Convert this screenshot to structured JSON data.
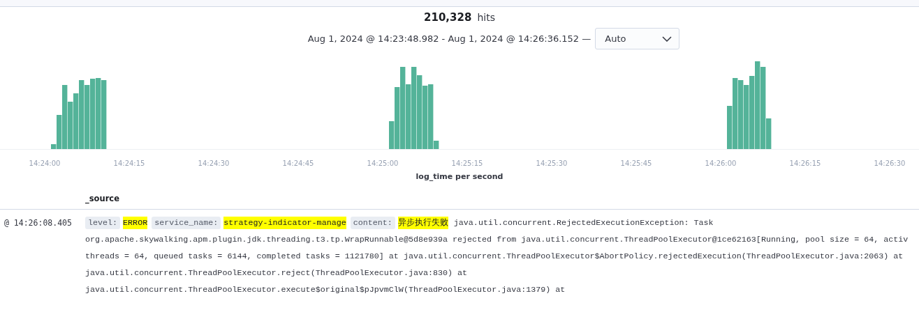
{
  "summary": {
    "hits_count": "210,328",
    "hits_label": "hits",
    "time_range": "Aug 1, 2024 @ 14:23:48.982 - Aug 1, 2024 @ 14:26:36.152 —",
    "interval": {
      "value": "Auto"
    }
  },
  "histogram": {
    "x_ticks": [
      "14:24:00",
      "14:24:15",
      "14:24:30",
      "14:24:45",
      "14:25:00",
      "14:25:15",
      "14:25:30",
      "14:25:45",
      "14:26:00",
      "14:26:15",
      "14:26:30"
    ],
    "x_label": "log_time per second"
  },
  "table": {
    "columns": [
      "_source"
    ],
    "rows": [
      {
        "timestamp": "@ 14:26:08.405",
        "fields": [
          {
            "key": "level:",
            "value": "ERROR"
          },
          {
            "key": "service_name:",
            "value": "strategy-indicator-manage"
          },
          {
            "key": "content:",
            "value": "异步执行失败"
          }
        ],
        "content_rest": "java.util.concurrent.RejectedExecutionException: Task",
        "lines": [
          "org.apache.skywalking.apm.plugin.jdk.threading.t3.tp.WrapRunnable@5d8e939a rejected from java.util.concurrent.ThreadPoolExecutor@1ce62163[Running, pool size = 64, activ",
          "threads = 64, queued tasks = 6144, completed tasks = 1121780] at java.util.concurrent.ThreadPoolExecutor$AbortPolicy.rejectedExecution(ThreadPoolExecutor.java:2063) at",
          "java.util.concurrent.ThreadPoolExecutor.reject(ThreadPoolExecutor.java:830) at",
          "java.util.concurrent.ThreadPoolExecutor.execute$original$pJpvmClW(ThreadPoolExecutor.java:1379) at"
        ]
      }
    ]
  }
}
